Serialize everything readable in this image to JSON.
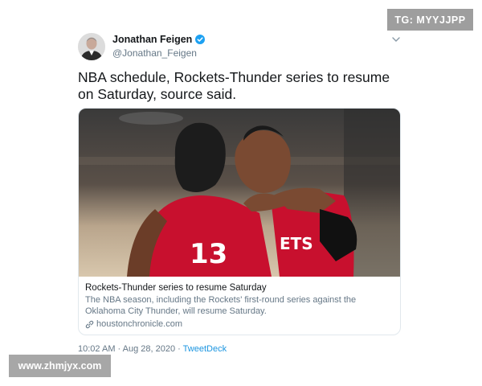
{
  "tweet": {
    "author_name": "Jonathan Feigen",
    "author_handle": "@Jonathan_Feigen",
    "verified": true,
    "text": "NBA schedule, Rockets-Thunder series to resume on Saturday, source said.",
    "timestamp": "10:02 AM · Aug 28, 2020",
    "separator": " · ",
    "source": "TweetDeck"
  },
  "card": {
    "title": "Rockets-Thunder series to resume Saturday",
    "description": "The NBA season, including the Rockets'   first-round series against the Oklahoma City Thunder, will resume Saturday.",
    "domain": "houstonchronicle.com",
    "image_jersey_number": "13",
    "image_jersey_text": "ETS"
  },
  "watermarks": {
    "top_right": "TG: MYYJJPP",
    "bottom_left": "www.zhmjyx.com"
  },
  "icons": {
    "verified": "verified-badge-icon",
    "menu": "chevron-down-icon",
    "link": "link-icon"
  },
  "colors": {
    "link_blue": "#1b95e0",
    "secondary_text": "#657786",
    "jersey_red": "#c8102e"
  }
}
